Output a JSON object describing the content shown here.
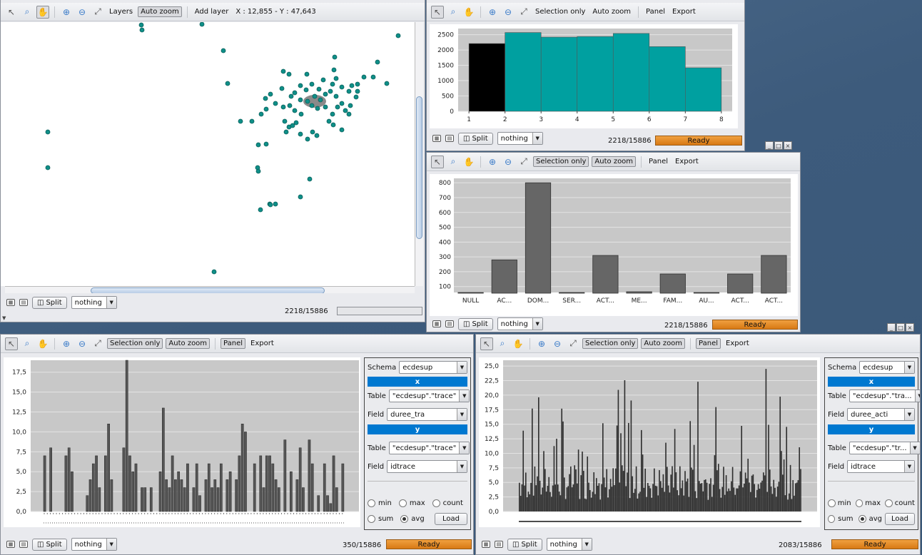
{
  "map_window": {
    "toolbar": {
      "layers": "Layers",
      "auto_zoom": "Auto zoom",
      "add_layer": "Add layer",
      "coords": "X : 12,855 - Y : 47,643"
    },
    "status": {
      "split": "Split",
      "combo": "nothing",
      "count": "2218/15886"
    },
    "points": [
      [
        197,
        35
      ],
      [
        198,
        42
      ],
      [
        282,
        34
      ],
      [
        312,
        71
      ],
      [
        557,
        50
      ],
      [
        528,
        87
      ],
      [
        468,
        80
      ],
      [
        396,
        100
      ],
      [
        404,
        104
      ],
      [
        429,
        104
      ],
      [
        467,
        98
      ],
      [
        470,
        110
      ],
      [
        318,
        117
      ],
      [
        371,
        138
      ],
      [
        378,
        132
      ],
      [
        385,
        145
      ],
      [
        394,
        124
      ],
      [
        407,
        135
      ],
      [
        412,
        130
      ],
      [
        420,
        120
      ],
      [
        428,
        126
      ],
      [
        436,
        118
      ],
      [
        440,
        135
      ],
      [
        448,
        140
      ],
      [
        446,
        125
      ],
      [
        455,
        132
      ],
      [
        462,
        128
      ],
      [
        470,
        135
      ],
      [
        478,
        122
      ],
      [
        488,
        128
      ],
      [
        492,
        120
      ],
      [
        500,
        128
      ],
      [
        498,
        136
      ],
      [
        452,
        112
      ],
      [
        465,
        118
      ],
      [
        420,
        140
      ],
      [
        430,
        142
      ],
      [
        436,
        148
      ],
      [
        444,
        152
      ],
      [
        455,
        150
      ],
      [
        465,
        160
      ],
      [
        472,
        150
      ],
      [
        478,
        145
      ],
      [
        483,
        155
      ],
      [
        490,
        148
      ],
      [
        405,
        148
      ],
      [
        412,
        155
      ],
      [
        421,
        160
      ],
      [
        396,
        150
      ],
      [
        372,
        153
      ],
      [
        365,
        160
      ],
      [
        352,
        170
      ],
      [
        336,
        170
      ],
      [
        398,
        170
      ],
      [
        404,
        178
      ],
      [
        409,
        176
      ],
      [
        414,
        172
      ],
      [
        437,
        185
      ],
      [
        443,
        190
      ],
      [
        460,
        170
      ],
      [
        466,
        175
      ],
      [
        478,
        182
      ],
      [
        488,
        160
      ],
      [
        500,
        118
      ],
      [
        509,
        108
      ],
      [
        522,
        108
      ],
      [
        541,
        117
      ],
      [
        420,
        188
      ],
      [
        400,
        185
      ],
      [
        430,
        195
      ],
      [
        372,
        202
      ],
      [
        361,
        203
      ],
      [
        66,
        185
      ],
      [
        66,
        235
      ],
      [
        360,
        235
      ],
      [
        361,
        240
      ],
      [
        433,
        251
      ],
      [
        420,
        276
      ],
      [
        377,
        286
      ],
      [
        378,
        287
      ],
      [
        385,
        286
      ],
      [
        364,
        294
      ],
      [
        299,
        381
      ]
    ]
  },
  "hist_window": {
    "toolbar": {
      "selection_only": "Selection only",
      "auto_zoom": "Auto zoom",
      "panel": "Panel",
      "export": "Export"
    },
    "status": {
      "split": "Split",
      "combo": "nothing",
      "count": "2218/15886",
      "state": "Ready"
    },
    "chart_data": {
      "type": "bar",
      "categories": [
        "1",
        "2",
        "3",
        "4",
        "5",
        "6",
        "7",
        "8"
      ],
      "bins": [
        [
          1,
          2
        ],
        [
          2,
          3
        ],
        [
          3,
          4
        ],
        [
          4,
          5
        ],
        [
          5,
          6
        ],
        [
          6,
          7
        ],
        [
          7,
          8
        ]
      ],
      "values": [
        2210,
        2570,
        2420,
        2440,
        2540,
        2110,
        1420
      ],
      "selected_bin": 0,
      "yticks": [
        "0",
        "500",
        "1000",
        "1500",
        "2000",
        "2500"
      ],
      "ylim": [
        0,
        2700
      ],
      "colors": {
        "selected": "#000000",
        "normal": "#00a0a0"
      }
    }
  },
  "cat_window": {
    "toolbar": {
      "selection_only": "Selection only",
      "auto_zoom": "Auto zoom",
      "panel": "Panel",
      "export": "Export"
    },
    "status": {
      "split": "Split",
      "combo": "nothing",
      "count": "2218/15886",
      "state": "Ready"
    },
    "chart_data": {
      "type": "bar",
      "categories": [
        "NULL",
        "AC...",
        "DOM...",
        "SER...",
        "ACT...",
        "ME...",
        "FAM...",
        "AU...",
        "ACT...",
        "ACT..."
      ],
      "values": [
        3,
        280,
        800,
        50,
        310,
        65,
        185,
        12,
        185,
        310
      ],
      "yticks": [
        "100",
        "200",
        "300",
        "400",
        "500",
        "600",
        "700",
        "800"
      ],
      "ylim": [
        60,
        830
      ]
    }
  },
  "left_agg_window": {
    "toolbar": {
      "selection_only": "Selection only",
      "auto_zoom": "Auto zoom",
      "panel": "Panel",
      "export": "Export"
    },
    "status": {
      "split": "Split",
      "combo": "nothing",
      "count": "350/15886",
      "state": "Ready"
    },
    "panel": {
      "schema_label": "Schema",
      "schema_value": "ecdesup",
      "x_header": "x",
      "x_table_label": "Table",
      "x_table_value": "\"ecdesup\".\"trace\"",
      "x_field_label": "Field",
      "x_field_value": "duree_tra",
      "y_header": "y",
      "y_table_label": "Table",
      "y_table_value": "\"ecdesup\".\"trace\"",
      "y_field_label": "Field",
      "y_field_value": "idtrace",
      "min": "min",
      "max": "max",
      "count": "count",
      "sum": "sum",
      "avg": "avg",
      "load": "Load"
    },
    "chart_data": {
      "type": "bar",
      "yticks": [
        "0,0",
        "2,5",
        "5,0",
        "7,5",
        "10,0",
        "12,5",
        "15,0",
        "17,5"
      ],
      "ylim": [
        0,
        19
      ],
      "values": [
        7,
        0,
        8,
        0,
        0,
        0,
        0,
        7,
        8,
        5,
        0,
        0,
        0,
        0,
        2,
        4,
        6,
        7,
        3,
        0,
        7,
        11,
        4,
        0,
        0,
        0,
        8,
        19,
        7,
        5,
        6,
        0,
        3,
        3,
        0,
        3,
        0,
        0,
        5,
        13,
        4,
        3,
        7,
        4,
        5,
        4,
        3,
        6,
        0,
        3,
        6,
        2,
        0,
        4,
        6,
        3,
        4,
        3,
        6,
        0,
        4,
        5,
        0,
        4,
        7,
        11,
        10,
        0,
        0,
        6,
        0,
        7,
        3,
        7,
        7,
        6,
        4,
        3,
        0,
        9,
        0,
        5,
        0,
        4,
        8,
        3,
        0,
        9,
        6,
        0,
        2,
        0,
        6,
        2,
        1,
        7,
        3,
        0,
        6
      ]
    }
  },
  "right_agg_window": {
    "toolbar": {
      "selection_only": "Selection only",
      "auto_zoom": "Auto zoom",
      "panel": "Panel",
      "export": "Export"
    },
    "status": {
      "split": "Split",
      "combo": "nothing",
      "count": "2083/15886",
      "state": "Ready"
    },
    "panel": {
      "schema_label": "Schema",
      "schema_value": "ecdesup",
      "x_header": "x",
      "x_table_label": "Table",
      "x_table_value": "\"ecdesup\".\"tra...",
      "x_field_label": "Field",
      "x_field_value": "duree_acti",
      "y_header": "y",
      "y_table_label": "Table",
      "y_table_value": "\"ecdesup\".\"tr...",
      "y_field_label": "Field",
      "y_field_value": "idtrace",
      "min": "min",
      "max": "max",
      "count": "count",
      "sum": "sum",
      "avg": "avg",
      "load": "Load"
    },
    "chart_data": {
      "type": "bar",
      "yticks": [
        "0,0",
        "2,5",
        "5,0",
        "7,5",
        "10,0",
        "12,5",
        "15,0",
        "17,5",
        "20,0",
        "22,5",
        "25,0"
      ],
      "ylim": [
        0,
        26
      ],
      "bar_count": 220
    }
  }
}
